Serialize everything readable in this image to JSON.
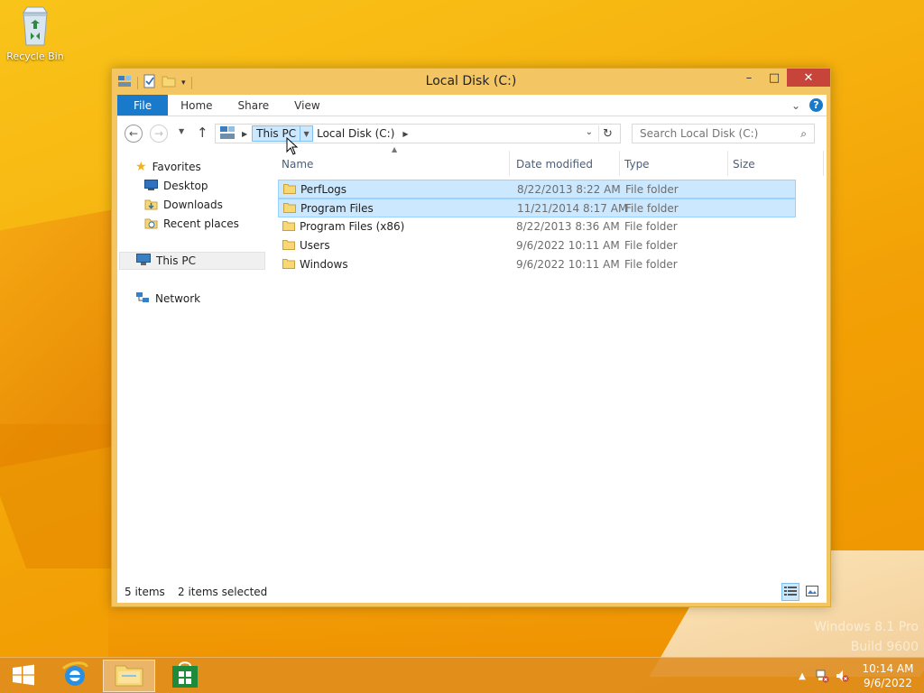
{
  "desktop": {
    "recycle_bin_label": "Recycle Bin",
    "watermark_line1": "Windows 8.1 Pro",
    "watermark_line2": "Build 9600"
  },
  "window": {
    "title": "Local Disk (C:)",
    "controls": {
      "minimize": "–",
      "maximize": "□",
      "close": "✕"
    }
  },
  "ribbon": {
    "tabs": [
      {
        "label": "File"
      },
      {
        "label": "Home"
      },
      {
        "label": "Share"
      },
      {
        "label": "View"
      }
    ],
    "collapse_glyph": "⌄",
    "help_glyph": "?"
  },
  "address": {
    "crumbs": [
      {
        "label": "This PC"
      },
      {
        "label": "Local Disk (C:)"
      }
    ]
  },
  "search": {
    "placeholder": "Search Local Disk (C:)"
  },
  "navpane": {
    "favorites": "Favorites",
    "desktop": "Desktop",
    "downloads": "Downloads",
    "recent": "Recent places",
    "this_pc": "This PC",
    "network": "Network"
  },
  "columns": {
    "name": "Name",
    "date": "Date modified",
    "type": "Type",
    "size": "Size"
  },
  "files": [
    {
      "name": "PerfLogs",
      "date": "8/22/2013 8:22 AM",
      "type": "File folder",
      "selected": true
    },
    {
      "name": "Program Files",
      "date": "11/21/2014 8:17 AM",
      "type": "File folder",
      "selected": true
    },
    {
      "name": "Program Files (x86)",
      "date": "8/22/2013 8:36 AM",
      "type": "File folder",
      "selected": false
    },
    {
      "name": "Users",
      "date": "9/6/2022 10:11 AM",
      "type": "File folder",
      "selected": false
    },
    {
      "name": "Windows",
      "date": "9/6/2022 10:11 AM",
      "type": "File folder",
      "selected": false
    }
  ],
  "status": {
    "count": "5 items",
    "selection": "2 items selected"
  },
  "taskbar": {
    "time": "10:14 AM",
    "date": "9/6/2022"
  },
  "colors": {
    "accent": "#1979ca",
    "selection": "#cce8ff",
    "close": "#c7443a",
    "window_frame": "#f3c663"
  }
}
